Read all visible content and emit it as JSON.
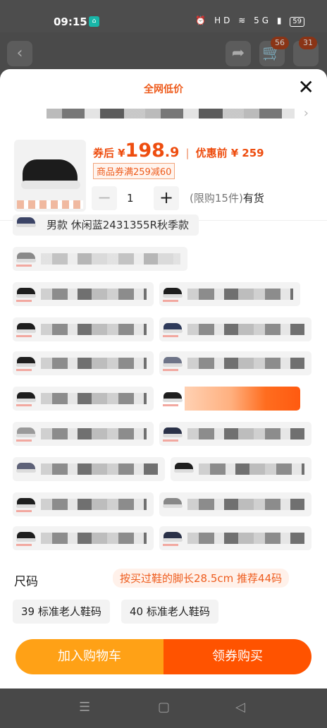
{
  "status": {
    "time": "09:15",
    "battery": "59",
    "icons": "⏰ HD ≋ 5G ▮"
  },
  "page": {
    "cart_count_1": "56",
    "cart_count_2": "31"
  },
  "sheet": {
    "title": "全网低价",
    "coupon_price_label": "券后",
    "currency": "¥",
    "price_int": "198",
    "price_dec": ".9",
    "original_label": "优惠前",
    "original_price": "259",
    "coupon_tag": "商品券满259减60",
    "quantity": "1",
    "limit_text": "(限购15件)",
    "stock_text": "有货"
  },
  "variants": {
    "first_label": "男款 休闲蓝2431355R秋季款"
  },
  "size": {
    "label": "尺码",
    "tip": "按买过鞋的脚长28.5cm 推荐44码",
    "options": [
      "39 标准老人鞋码",
      "40 标准老人鞋码"
    ]
  },
  "actions": {
    "add_to_cart": "加入购物车",
    "buy_with_coupon": "领券购买"
  },
  "colors": {
    "accent": "#ff5300",
    "secondary": "#ffa116",
    "price": "#ee4d0f"
  }
}
